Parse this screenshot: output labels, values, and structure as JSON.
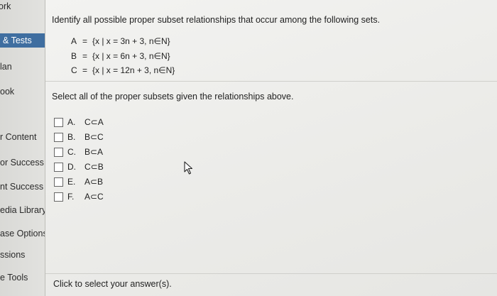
{
  "sidebar": {
    "items": [
      {
        "label": "ork"
      },
      {
        "label": "& Tests"
      },
      {
        "label": "lan"
      },
      {
        "label": "ook"
      },
      {
        "label": "r Content"
      },
      {
        "label": "or Success"
      },
      {
        "label": "nt Success"
      },
      {
        "label": "edia Library"
      },
      {
        "label": "ase Options"
      },
      {
        "label": "ssions"
      },
      {
        "label": "e Tools"
      }
    ]
  },
  "question": {
    "prompt": "Identify all possible proper subset relationships that occur among the following sets.",
    "sets": [
      {
        "name": "A",
        "definition": "{x | x = 3n + 3, n∈N}"
      },
      {
        "name": "B",
        "definition": "{x | x = 6n + 3, n∈N}"
      },
      {
        "name": "C",
        "definition": "{x | x = 12n + 3, n∈N}"
      }
    ],
    "instruction": "Select all of the proper subsets given the relationships above.",
    "choices": [
      {
        "letter": "A.",
        "text": "C⊂A"
      },
      {
        "letter": "B.",
        "text": "B⊂C"
      },
      {
        "letter": "C.",
        "text": "B⊂A"
      },
      {
        "letter": "D.",
        "text": "C⊂B"
      },
      {
        "letter": "E.",
        "text": "A⊂B"
      },
      {
        "letter": "F.",
        "text": "A⊂C"
      }
    ]
  },
  "footer": {
    "hint": "Click to select your answer(s)."
  }
}
